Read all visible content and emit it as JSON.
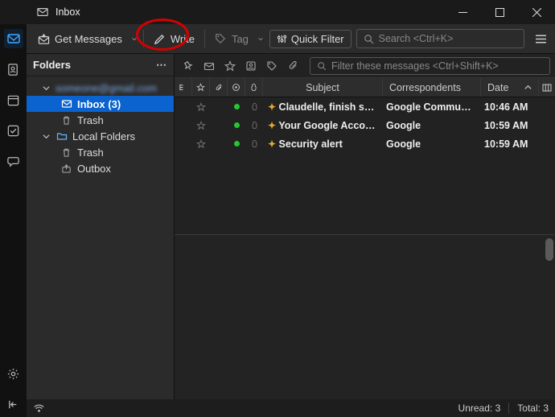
{
  "window": {
    "title": "Inbox"
  },
  "toolbar": {
    "get_messages": "Get Messages",
    "write": "Write",
    "tag": "Tag",
    "quick_filter": "Quick Filter",
    "search_placeholder": "Search <Ctrl+K>"
  },
  "folders": {
    "header": "Folders",
    "account_blurred": "someone@gmail.com",
    "inbox": "Inbox (3)",
    "trash": "Trash",
    "local": "Local Folders",
    "local_trash": "Trash",
    "outbox": "Outbox"
  },
  "msg_toolbar": {
    "filter_placeholder": "Filter these messages <Ctrl+Shift+K>"
  },
  "columns": {
    "subject": "Subject",
    "correspondents": "Correspondents",
    "date": "Date"
  },
  "messages": [
    {
      "subject": "Claudelle, finish s…",
      "corr": "Google Community …",
      "date": "10:46 AM"
    },
    {
      "subject": "Your Google Acco…",
      "corr": "Google",
      "date": "10:59 AM"
    },
    {
      "subject": "Security alert",
      "corr": "Google",
      "date": "10:59 AM"
    }
  ],
  "status": {
    "unread_label": "Unread:",
    "unread_count": "3",
    "total_label": "Total:",
    "total_count": "3"
  }
}
